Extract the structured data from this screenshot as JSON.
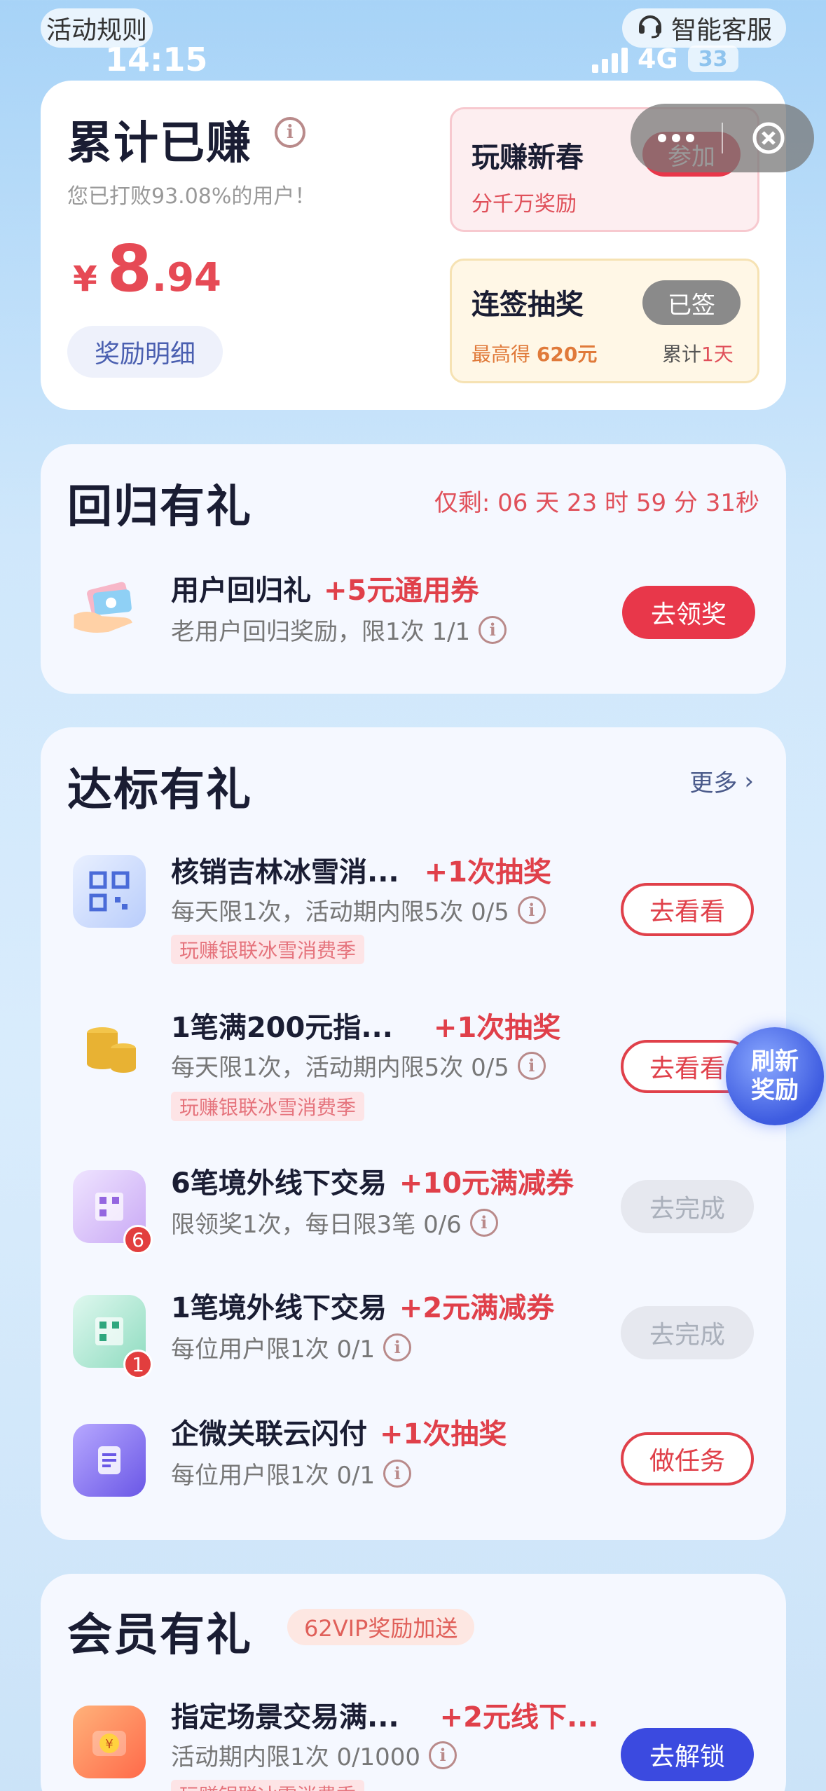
{
  "topbar": {
    "rules": "活动规则",
    "service": "智能客服"
  },
  "status": {
    "time": "14:15",
    "network": "4G",
    "battery": "33"
  },
  "earnings": {
    "title": "累计已赚",
    "subtitle": "您已打败93.08%的用户！",
    "currency": "¥",
    "amount_int": "8",
    "amount_dec": ".94",
    "detail_btn": "奖励明细"
  },
  "promo1": {
    "title": "玩赚新春",
    "sub": "分千万奖励",
    "btn": "参加"
  },
  "promo2": {
    "title": "连签抽奖",
    "sub_prefix": "最高得",
    "sub_value": "620元",
    "btn": "已签",
    "streak_prefix": "累计",
    "streak_value": "1天"
  },
  "return_gift": {
    "title": "回归有礼",
    "countdown": "仅剩: 06 天 23 时 59 分 31秒",
    "task": {
      "name": "用户回归礼",
      "reward": "+5元通用券",
      "desc": "老用户回归奖励，限1次 1/1",
      "btn": "去领奖"
    }
  },
  "milestone": {
    "title": "达标有礼",
    "more": "更多",
    "tasks": [
      {
        "name": "核销吉林冰雪消...",
        "reward": "+1次抽奖",
        "desc": "每天限1次，活动期内限5次 0/5",
        "tag": "玩赚银联冰雪消费季",
        "btn": "去看看"
      },
      {
        "name": "1笔满200元指...",
        "reward": "+1次抽奖",
        "desc": "每天限1次，活动期内限5次 0/5",
        "tag": "玩赚银联冰雪消费季",
        "btn": "去看看"
      },
      {
        "name": "6笔境外线下交易",
        "reward": "+10元满减券",
        "desc": "限领奖1次，每日限3笔 0/6",
        "badge": "6",
        "btn": "去完成"
      },
      {
        "name": "1笔境外线下交易",
        "reward": "+2元满减券",
        "desc": "每位用户限1次 0/1",
        "badge": "1",
        "btn": "去完成"
      },
      {
        "name": "企微关联云闪付",
        "reward": "+1次抽奖",
        "desc": "每位用户限1次 0/1",
        "btn": "做任务"
      }
    ]
  },
  "float_refresh": {
    "line1": "刷新",
    "line2": "奖励"
  },
  "vip": {
    "title": "会员有礼",
    "badge": "62VIP奖励加送",
    "task": {
      "name": "指定场景交易满...",
      "reward": "+2元线下...",
      "desc": "活动期内限1次 0/1000",
      "tag": "玩赚银联冰雪消费季",
      "btn": "去解锁"
    }
  },
  "colors": {
    "accent_red": "#e0404a",
    "blue_btn": "#3b4ae0"
  }
}
